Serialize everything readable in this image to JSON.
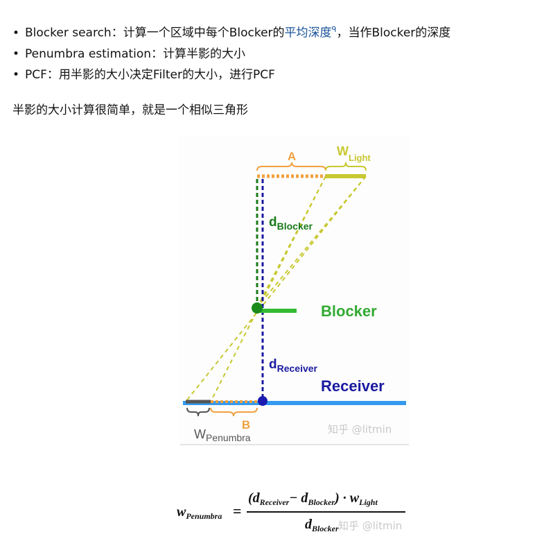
{
  "bullets": [
    {
      "term": "Blocker search",
      "sep": "：",
      "text_before": "计算一个区域中每个Blocker的",
      "link": "平均深度",
      "link_icon": "ᑫ",
      "text_after": "，当作Blocker的深度"
    },
    {
      "term": "Penumbra estimation",
      "sep": "：",
      "text_before": "计算半影的大小",
      "link": "",
      "link_icon": "",
      "text_after": ""
    },
    {
      "term": "PCF",
      "sep": "：",
      "text_before": "用半影的大小决定Filter的大小，进行PCF",
      "link": "",
      "link_icon": "",
      "text_after": ""
    }
  ],
  "paragraph": "半影的大小计算很简单，就是一个相似三角形",
  "diagram": {
    "label_A": "A",
    "label_W": "W",
    "label_Light_sub": "Light",
    "label_d": "d",
    "label_Blocker_sub": "Blocker",
    "label_Blocker": "Blocker",
    "label_Receiver_sub": "Receiver",
    "label_Receiver": "Receiver",
    "label_B": "B",
    "label_Penumbra_sub": "Penumbra",
    "watermark": "知乎 @litmin",
    "colors": {
      "orange": "#f0a040",
      "yellow": "#c8c832",
      "green_dark": "#1a7a1a",
      "green": "#33bb33",
      "navy": "#1a1aa0",
      "blue": "#3399ee"
    }
  },
  "formula": {
    "lhs": "w",
    "lhs_sub": "Penumbra",
    "eq": "=",
    "num_open": "(d",
    "num_sub1": "Receiver",
    "num_minus": "− d",
    "num_sub2": "Blocker",
    "num_close": ") · w",
    "num_sub3": "Light",
    "den_d": "d",
    "den_sub": "Blocker",
    "watermark": "知乎 @litmin"
  }
}
